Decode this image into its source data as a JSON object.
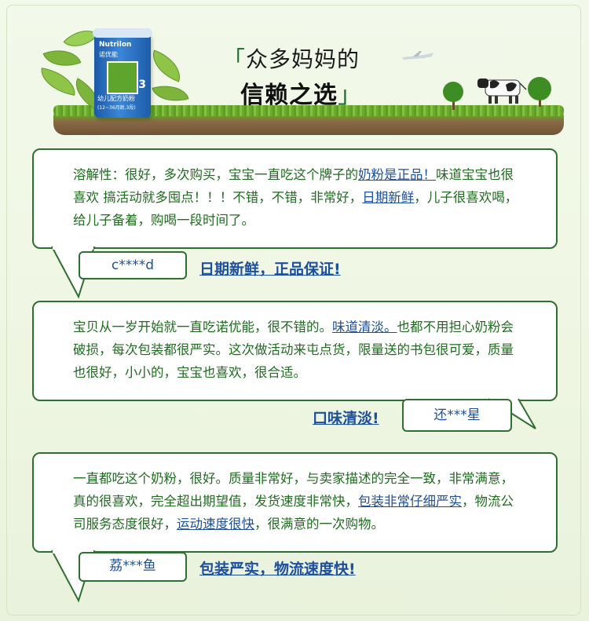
{
  "banner": {
    "title_line1": "众多妈妈的",
    "title_line2": "信赖之选",
    "product": {
      "brand": "Nutrilon",
      "brand_cn": "诺优能",
      "stage": "3",
      "label": "幼儿配方奶粉",
      "age": "(12~36月龄,3段)"
    }
  },
  "reviews": [
    {
      "parts": [
        {
          "t": "溶解性：很好，多次购买，宝宝一直吃这个牌子的",
          "hl": false
        },
        {
          "t": "奶粉是正品！",
          "hl": true
        },
        {
          "t": "味道宝宝也很喜欢 搞活动就多囤点！！！不错，不错，非常好，",
          "hl": false
        },
        {
          "t": "日期新鲜",
          "hl": true
        },
        {
          "t": "，儿子很喜欢喝，给儿子备着，购喝一段时间了。",
          "hl": false
        }
      ],
      "user": "c****d",
      "tag": "日期新鲜，正品保证!"
    },
    {
      "parts": [
        {
          "t": "宝贝从一岁开始就一直吃诺优能，很不错的。",
          "hl": false
        },
        {
          "t": "味道清淡。",
          "hl": true
        },
        {
          "t": "也都不用担心奶粉会破损，每次包装都很严实。这次做活动来屯点货，限量送的书包很可爱，质量也很好，小小的，宝宝也喜欢，很合适。",
          "hl": false
        }
      ],
      "user": "还***星",
      "tag": "口味清淡!"
    },
    {
      "parts": [
        {
          "t": "一直都吃这个奶粉，很好。质量非常好，与卖家描述的完全一致，非常满意，真的很喜欢，完全超出期望值，发货速度非常快，",
          "hl": false
        },
        {
          "t": "包装非常仔细严实",
          "hl": true
        },
        {
          "t": "，物流公司服务态度很好，",
          "hl": false
        },
        {
          "t": "运动速度很快",
          "hl": true
        },
        {
          "t": "，很满意的一次购物。",
          "hl": false
        }
      ],
      "user": "荔***鱼",
      "tag": "包装严实，物流速度快!"
    }
  ],
  "colors": {
    "bubble_border": "#2f6f2f",
    "text": "#1f6b1f",
    "highlight": "#1d4f9c"
  },
  "icons": [
    "leaf-icon",
    "cow-icon",
    "tree-icon",
    "airplane-icon",
    "milk-can-icon"
  ]
}
